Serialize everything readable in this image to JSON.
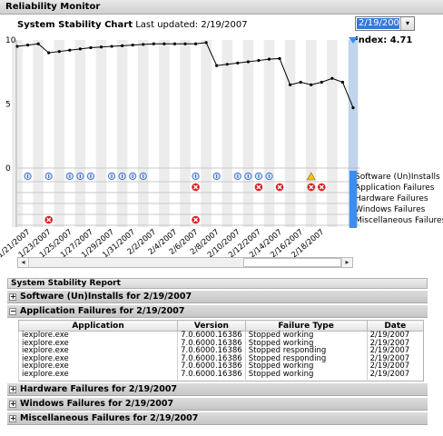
{
  "window": {
    "title": "Reliability Monitor"
  },
  "chart": {
    "heading": "System Stability Chart",
    "last_updated": "Last updated: 2/19/2007",
    "index_label": "Index: 4.71",
    "selected_date": "2/19/2007",
    "y_ticks": [
      "10",
      "5",
      "0"
    ],
    "row_labels": [
      "Software (Un)Installs",
      "Application Failures",
      "Hardware Failures",
      "Windows Failures",
      "Miscellaneous Failures"
    ]
  },
  "chart_data": {
    "type": "line",
    "title": "System Stability Chart",
    "ylim": [
      0,
      10
    ],
    "x_tick_labels": [
      "1/21/2007",
      "1/23/2007",
      "1/25/2007",
      "1/27/2007",
      "1/29/2007",
      "1/31/2007",
      "2/2/2007",
      "2/4/2007",
      "2/6/2007",
      "2/8/2007",
      "2/10/2007",
      "2/12/2007",
      "2/14/2007",
      "2/16/2007",
      "2/18/2007"
    ],
    "x": [
      "1/20/2007",
      "1/21/2007",
      "1/22/2007",
      "1/23/2007",
      "1/24/2007",
      "1/25/2007",
      "1/26/2007",
      "1/27/2007",
      "1/28/2007",
      "1/29/2007",
      "1/30/2007",
      "1/31/2007",
      "2/1/2007",
      "2/2/2007",
      "2/3/2007",
      "2/4/2007",
      "2/5/2007",
      "2/6/2007",
      "2/7/2007",
      "2/8/2007",
      "2/9/2007",
      "2/10/2007",
      "2/11/2007",
      "2/12/2007",
      "2/13/2007",
      "2/14/2007",
      "2/15/2007",
      "2/16/2007",
      "2/17/2007",
      "2/18/2007",
      "2/19/2007"
    ],
    "series": [
      {
        "values": [
          9.5,
          9.6,
          9.7,
          9.0,
          9.1,
          9.2,
          9.3,
          9.4,
          9.45,
          9.5,
          9.55,
          9.6,
          9.65,
          9.7,
          9.7,
          9.7,
          9.7,
          9.7,
          9.8,
          8.0,
          8.1,
          8.2,
          8.3,
          8.4,
          8.5,
          8.55,
          6.5,
          6.7,
          6.5,
          6.7,
          7.0,
          6.7,
          4.71
        ]
      }
    ],
    "event_rows": {
      "Software (Un)Installs": {
        "icon": "info",
        "x_index": [
          1,
          3,
          5,
          6,
          7,
          9,
          10,
          11,
          12,
          17,
          19,
          21,
          22,
          23,
          24
        ]
      },
      "Software (Un)Installs warning": {
        "icon": "warning",
        "x_index": [
          28
        ]
      },
      "Application Failures": {
        "icon": "error",
        "x_index": [
          17,
          23,
          25,
          28,
          29
        ]
      },
      "Miscellaneous Failures": {
        "icon": "error",
        "x_index": [
          3,
          17
        ]
      }
    },
    "colors": {
      "line": "#000000",
      "stripe": "#ececec",
      "selection": "#3b8ef0",
      "error": "#d42020",
      "info": "#3a6fc8",
      "warning": "#f0c020"
    }
  },
  "report": {
    "title": "System Stability Report",
    "sections": {
      "software": "Software (Un)Installs for 2/19/2007",
      "application": "Application Failures for 2/19/2007",
      "hardware": "Hardware Failures for 2/19/2007",
      "windows": "Windows Failures for 2/19/2007",
      "misc": "Miscellaneous Failures for 2/19/2007"
    },
    "toggles": {
      "collapsed": "+",
      "expanded": "−"
    },
    "columns": [
      "Application",
      "Version",
      "Failure Type",
      "Date"
    ],
    "rows": [
      [
        "iexplore.exe",
        "7.0.6000.16386",
        "Stopped working",
        "2/19/2007"
      ],
      [
        "iexplore.exe",
        "7.0.6000.16386",
        "Stopped working",
        "2/19/2007"
      ],
      [
        "iexplore.exe",
        "7.0.6000.16386",
        "Stopped responding",
        "2/19/2007"
      ],
      [
        "iexplore.exe",
        "7.0.6000.16386",
        "Stopped responding",
        "2/19/2007"
      ],
      [
        "iexplore.exe",
        "7.0.6000.16386",
        "Stopped working",
        "2/19/2007"
      ],
      [
        "iexplore.exe",
        "7.0.6000.16386",
        "Stopped working",
        "2/19/2007"
      ]
    ]
  },
  "scrollbar": {
    "left_arrow": "◂",
    "right_arrow": "▸"
  },
  "dropdown_arrow": "▾"
}
